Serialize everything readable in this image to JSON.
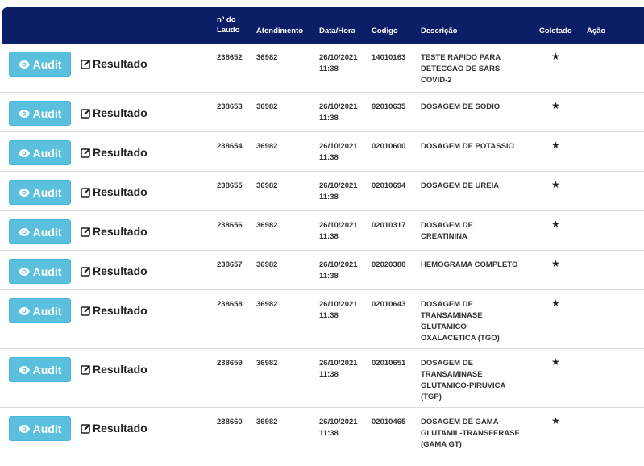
{
  "header": {
    "laudo": "nº do Laudo",
    "atendimento": "Atendimento",
    "datahora": "Data/Hora",
    "codigo": "Codigo",
    "descricao": "Descrição",
    "coletado": "Coletado",
    "acao": "Ação"
  },
  "buttons": {
    "audit": "Audit",
    "resultado": "Resultado"
  },
  "icons": {
    "audit": "eye-icon",
    "resultado": "edit-square-icon",
    "coletado": "star-icon"
  },
  "colors": {
    "header_bg": "#0c1f66",
    "audit_bg": "#5bc0de"
  },
  "rows": [
    {
      "laudo": "238652",
      "atendimento": "36982",
      "data": "26/10/2021",
      "hora": "11:38",
      "codigo": "14010163",
      "descricao": "TESTE RAPIDO PARA DETECCAO DE SARS-COVID-2",
      "coletado": "★"
    },
    {
      "laudo": "238653",
      "atendimento": "36982",
      "data": "26/10/2021",
      "hora": "11:38",
      "codigo": "02010635",
      "descricao": "DOSAGEM DE SODIO",
      "coletado": "★"
    },
    {
      "laudo": "238654",
      "atendimento": "36982",
      "data": "26/10/2021",
      "hora": "11:38",
      "codigo": "02010600",
      "descricao": "DOSAGEM DE POTASSIO",
      "coletado": "★"
    },
    {
      "laudo": "238655",
      "atendimento": "36982",
      "data": "26/10/2021",
      "hora": "11:38",
      "codigo": "02010694",
      "descricao": "DOSAGEM DE UREIA",
      "coletado": "★"
    },
    {
      "laudo": "238656",
      "atendimento": "36982",
      "data": "26/10/2021",
      "hora": "11:38",
      "codigo": "02010317",
      "descricao": "DOSAGEM DE CREATININA",
      "coletado": "★"
    },
    {
      "laudo": "238657",
      "atendimento": "36982",
      "data": "26/10/2021",
      "hora": "11:38",
      "codigo": "02020380",
      "descricao": "HEMOGRAMA COMPLETO",
      "coletado": "★"
    },
    {
      "laudo": "238658",
      "atendimento": "36982",
      "data": "26/10/2021",
      "hora": "11:38",
      "codigo": "02010643",
      "descricao": "DOSAGEM DE TRANSAMINASE GLUTAMICO-OXALACETICA (TGO)",
      "coletado": "★"
    },
    {
      "laudo": "238659",
      "atendimento": "36982",
      "data": "26/10/2021",
      "hora": "11:38",
      "codigo": "02010651",
      "descricao": "DOSAGEM DE TRANSAMINASE GLUTAMICO-PIRUVICA (TGP)",
      "coletado": "★"
    },
    {
      "laudo": "238660",
      "atendimento": "36982",
      "data": "26/10/2021",
      "hora": "11:38",
      "codigo": "02010465",
      "descricao": "DOSAGEM DE GAMA-GLUTAMIL-TRANSFERASE (GAMA GT)",
      "coletado": "★"
    }
  ]
}
